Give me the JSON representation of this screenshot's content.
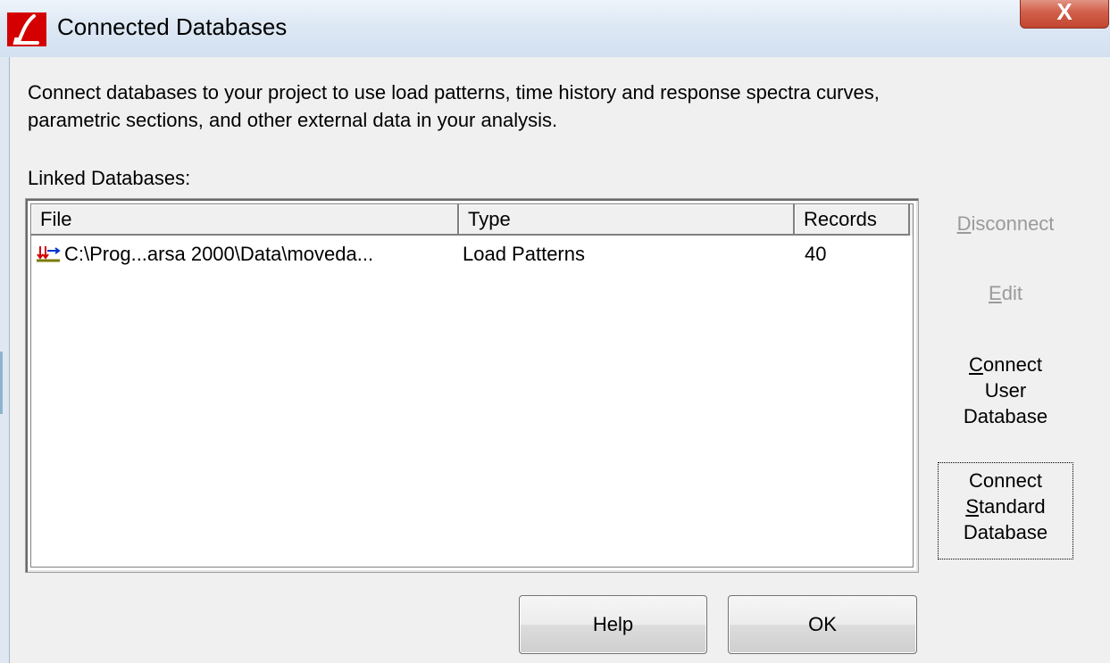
{
  "window": {
    "title": "Connected Databases",
    "close_label": "X"
  },
  "description": {
    "line1": "Connect databases to your project to use load patterns, time history and response spectra curves,",
    "line2": "parametric sections, and other external data in your analysis."
  },
  "linked_label": "Linked Databases:",
  "table": {
    "columns": [
      "File",
      "Type",
      "Records"
    ],
    "rows": [
      {
        "file": "C:\\Prog...arsa 2000\\Data\\moveda...",
        "type": "Load Patterns",
        "records": "40",
        "icon": "load-pattern-icon"
      }
    ]
  },
  "side_buttons": {
    "disconnect": {
      "mnemonic": "D",
      "rest": "isconnect"
    },
    "edit": {
      "mnemonic": "E",
      "rest": "dit"
    },
    "connect_user": {
      "line1_mnemonic": "C",
      "line1_rest": "onnect",
      "line2": "User",
      "line3": "Database"
    },
    "connect_standard": {
      "line1": "Connect",
      "line2_mnemonic": "S",
      "line2_rest": "tandard",
      "line3": "Database"
    }
  },
  "bottom_buttons": {
    "help": "Help",
    "ok": "OK"
  },
  "colors": {
    "titlebar": "#dde8f4",
    "close_button": "#d2604c",
    "dialog_bg": "#f0f0f0",
    "disabled_text": "#9a9a9a"
  }
}
